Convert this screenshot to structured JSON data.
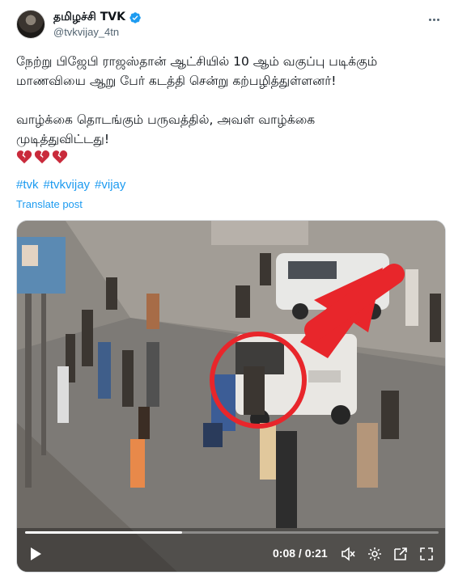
{
  "author": {
    "display_name": "தமிழச்சி TVK",
    "handle": "@tvkvijay_4tn",
    "verified": true
  },
  "post": {
    "lines_para1": [
      "நேற்று பிஜேபி ராஜஸ்தான் ஆட்சியில் 10 ஆம் வகுப்பு படிக்கும்",
      "மாணவியை ஆறு பேர் கடத்தி சென்று கற்பழித்துள்ளனர்!"
    ],
    "lines_para2": [
      "வாழ்க்கை தொடங்கும் பருவத்தில், அவள் வாழ்க்கை",
      "முடித்துவிட்டது!"
    ],
    "emoji": [
      "broken-heart",
      "broken-heart",
      "broken-heart"
    ],
    "hashtags": [
      "#tvk",
      "#tvkvijay",
      "#vijay"
    ],
    "translate_label": "Translate post"
  },
  "video": {
    "time_display": "0:08 / 0:21",
    "progress": 0.38,
    "annotation_color": "#e8262b"
  },
  "colors": {
    "link": "#1d9bf0",
    "secondary_text": "#536471",
    "heart": "#c92a3b"
  }
}
